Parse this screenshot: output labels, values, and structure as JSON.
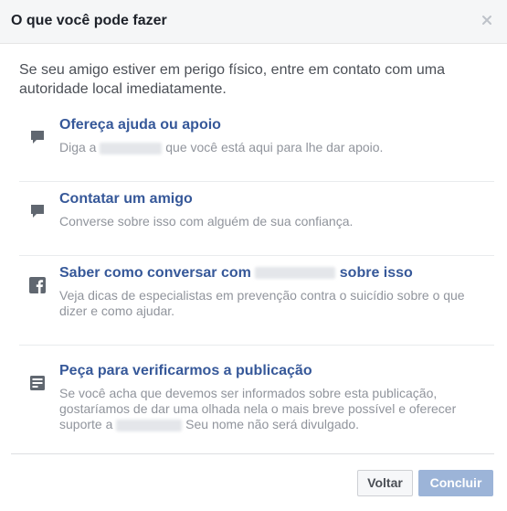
{
  "dialog": {
    "title": "O que você pode fazer",
    "close_icon": "close-icon"
  },
  "intro": "Se seu amigo estiver em perigo físico, entre em contato com uma autoridade local imediatamente.",
  "options": [
    {
      "icon": "speech-bubble-icon",
      "title": "Ofereça ajuda ou apoio",
      "desc_before": "Diga a",
      "desc_after": "que você está aqui para lhe dar apoio."
    },
    {
      "icon": "speech-bubble-icon",
      "title": "Contatar um amigo",
      "desc": "Converse sobre isso com alguém de sua confiança."
    },
    {
      "icon": "facebook-icon",
      "title_before": "Saber como conversar com",
      "title_after": "sobre isso",
      "desc": "Veja dicas de especialistas em prevenção contra o suicídio sobre o que dizer e como ajudar."
    },
    {
      "icon": "post-icon",
      "title": "Peça para verificarmos a publicação",
      "desc_before": "Se você acha que devemos ser informados sobre esta publicação, gostaríamos de dar uma olhada nela o mais breve possível e oferecer suporte a",
      "desc_after": "Seu nome não será divulgado."
    }
  ],
  "footer": {
    "cancel_label": "Voltar",
    "done_label": "Concluir"
  },
  "colors": {
    "link": "#365899",
    "primary_disabled": "#9cb4d8"
  }
}
